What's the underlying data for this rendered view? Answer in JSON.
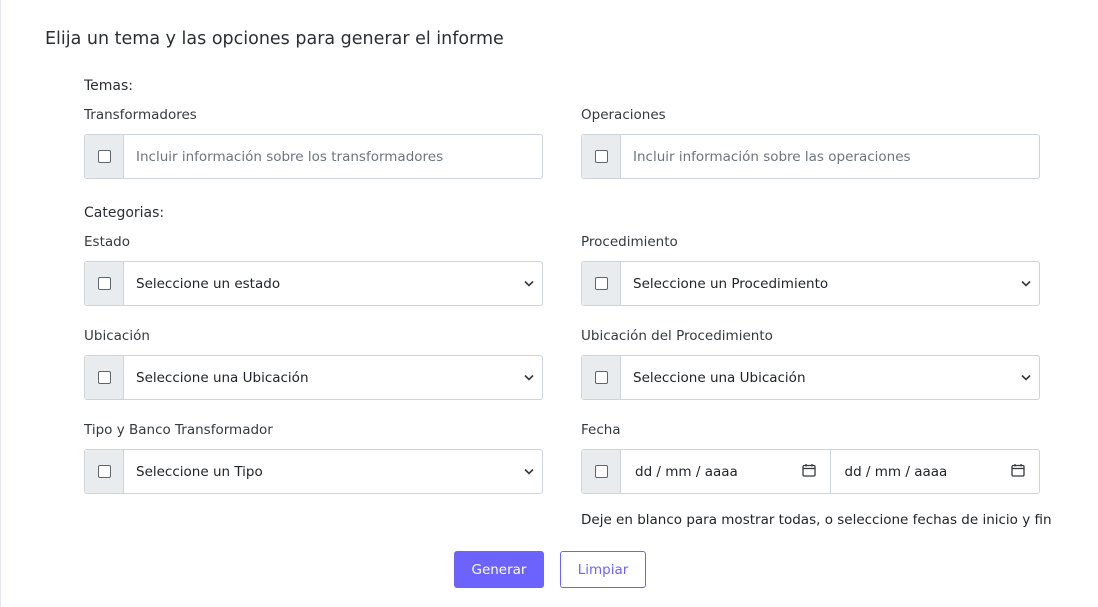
{
  "title": "Elija un tema y las opciones para generar el informe",
  "temas": {
    "label": "Temas:",
    "transformadores": {
      "label": "Transformadores",
      "placeholder": "Incluir información sobre los transformadores"
    },
    "operaciones": {
      "label": "Operaciones",
      "placeholder": "Incluir información sobre las operaciones"
    }
  },
  "categorias": {
    "label": "Categorias:",
    "estado": {
      "label": "Estado",
      "selected": "Seleccione un estado"
    },
    "procedimiento": {
      "label": "Procedimiento",
      "selected": "Seleccione un Procedimiento"
    },
    "ubicacion": {
      "label": "Ubicación",
      "selected": "Seleccione una Ubicación"
    },
    "ubicacion_procedimiento": {
      "label": "Ubicación del Procedimiento",
      "selected": "Seleccione una Ubicación"
    },
    "tipo_banco": {
      "label": "Tipo y Banco Transformador",
      "selected": "Seleccione un Tipo"
    },
    "fecha": {
      "label": "Fecha",
      "start_placeholder": "dd / mm / aaaa",
      "end_placeholder": "dd / mm / aaaa",
      "hint": "Deje en blanco para mostrar todas, o seleccione fechas de inicio y fin"
    }
  },
  "buttons": {
    "generar": "Generar",
    "limpiar": "Limpiar"
  },
  "colors": {
    "primary": "#6c63ff",
    "addon_bg": "#e9ecef",
    "border": "#ced4da"
  },
  "icons": {
    "select_indicator": "chevron-down-icon",
    "date_picker": "calendar-icon"
  }
}
